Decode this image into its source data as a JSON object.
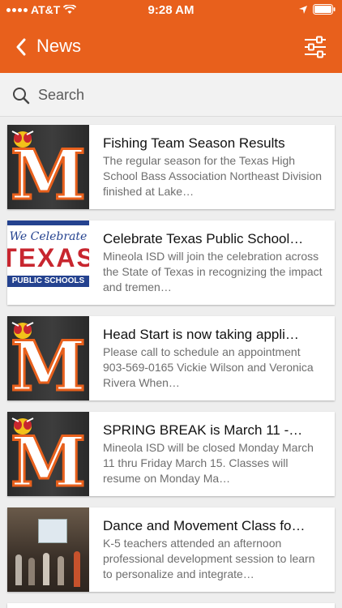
{
  "status_bar": {
    "carrier": "AT&T",
    "time": "9:28 AM"
  },
  "nav": {
    "back_label": "‹",
    "title": "News"
  },
  "search": {
    "label": "Search"
  },
  "articles": [
    {
      "title": "Fishing Team Season Results",
      "summary": "The regular season for the Texas High School Bass Association Northeast Division finished at Lake…",
      "thumb": "mineola-m-logo"
    },
    {
      "title": "Celebrate Texas Public School…",
      "summary": "Mineola ISD will join the celebration across the State of Texas in recognizing the impact and tremen…",
      "thumb": "celebrate-texas-public-schools",
      "thumb_text": {
        "line1": "We Celebrate",
        "line2": "TEXAS",
        "line3": "PUBLIC SCHOOLS"
      }
    },
    {
      "title": "Head Start is now taking appli…",
      "summary": "Please call to schedule an appointment 903-569-0165 Vickie Wilson and Veronica Rivera When…",
      "thumb": "mineola-m-logo"
    },
    {
      "title": "SPRING BREAK is March 11 -…",
      "summary": "Mineola ISD will be closed Monday March 11 thru Friday March 15. Classes will resume on Monday Ma…",
      "thumb": "mineola-m-logo"
    },
    {
      "title": "Dance and Movement Class fo…",
      "summary": "K-5 teachers attended an afternoon professional development session to learn to personalize and integrate…",
      "thumb": "classroom-photo"
    }
  ],
  "colors": {
    "brand": "#e8601c",
    "background": "#eeeeee",
    "title_text": "#111111",
    "summary_text": "#6e6e6e"
  },
  "icons": {
    "back": "chevron-left-icon",
    "filter": "sliders-icon",
    "search": "search-icon",
    "wifi": "wifi-icon",
    "location": "location-arrow-icon",
    "battery": "battery-icon"
  }
}
